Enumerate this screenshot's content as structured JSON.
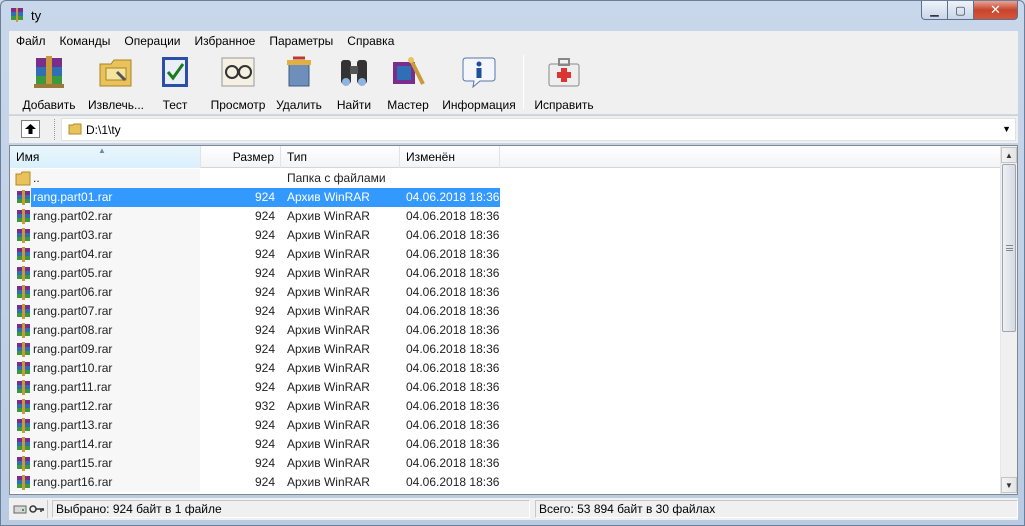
{
  "window": {
    "title": "ty"
  },
  "menu": [
    "Файл",
    "Команды",
    "Операции",
    "Избранное",
    "Параметры",
    "Справка"
  ],
  "toolbar": {
    "add": "Добавить",
    "extract": "Извлечь...",
    "test": "Тест",
    "view": "Просмотр",
    "delete": "Удалить",
    "find": "Найти",
    "wizard": "Мастер",
    "info": "Информация",
    "repair": "Исправить"
  },
  "address": {
    "path": "D:\\1\\ty"
  },
  "columns": {
    "name": "Имя",
    "size": "Размер",
    "type": "Тип",
    "modified": "Изменён"
  },
  "parent_row": {
    "name": "..",
    "type": "Папка с файлами"
  },
  "files": [
    {
      "name": "rang.part01.rar",
      "size": "924",
      "type": "Архив WinRAR",
      "modified": "04.06.2018 18:36",
      "selected": true
    },
    {
      "name": "rang.part02.rar",
      "size": "924",
      "type": "Архив WinRAR",
      "modified": "04.06.2018 18:36"
    },
    {
      "name": "rang.part03.rar",
      "size": "924",
      "type": "Архив WinRAR",
      "modified": "04.06.2018 18:36"
    },
    {
      "name": "rang.part04.rar",
      "size": "924",
      "type": "Архив WinRAR",
      "modified": "04.06.2018 18:36"
    },
    {
      "name": "rang.part05.rar",
      "size": "924",
      "type": "Архив WinRAR",
      "modified": "04.06.2018 18:36"
    },
    {
      "name": "rang.part06.rar",
      "size": "924",
      "type": "Архив WinRAR",
      "modified": "04.06.2018 18:36"
    },
    {
      "name": "rang.part07.rar",
      "size": "924",
      "type": "Архив WinRAR",
      "modified": "04.06.2018 18:36"
    },
    {
      "name": "rang.part08.rar",
      "size": "924",
      "type": "Архив WinRAR",
      "modified": "04.06.2018 18:36"
    },
    {
      "name": "rang.part09.rar",
      "size": "924",
      "type": "Архив WinRAR",
      "modified": "04.06.2018 18:36"
    },
    {
      "name": "rang.part10.rar",
      "size": "924",
      "type": "Архив WinRAR",
      "modified": "04.06.2018 18:36"
    },
    {
      "name": "rang.part11.rar",
      "size": "924",
      "type": "Архив WinRAR",
      "modified": "04.06.2018 18:36"
    },
    {
      "name": "rang.part12.rar",
      "size": "932",
      "type": "Архив WinRAR",
      "modified": "04.06.2018 18:36"
    },
    {
      "name": "rang.part13.rar",
      "size": "924",
      "type": "Архив WinRAR",
      "modified": "04.06.2018 18:36"
    },
    {
      "name": "rang.part14.rar",
      "size": "924",
      "type": "Архив WinRAR",
      "modified": "04.06.2018 18:36"
    },
    {
      "name": "rang.part15.rar",
      "size": "924",
      "type": "Архив WinRAR",
      "modified": "04.06.2018 18:36"
    },
    {
      "name": "rang.part16.rar",
      "size": "924",
      "type": "Архив WinRAR",
      "modified": "04.06.2018 18:36"
    }
  ],
  "status": {
    "selected": "Выбрано: 924 байт в 1 файле",
    "total": "Всего: 53 894 байт в 30 файлах"
  },
  "colors": {
    "selection": "#3399ff",
    "titlebar": "#c9d7ea",
    "close_button": "#c7452d"
  }
}
